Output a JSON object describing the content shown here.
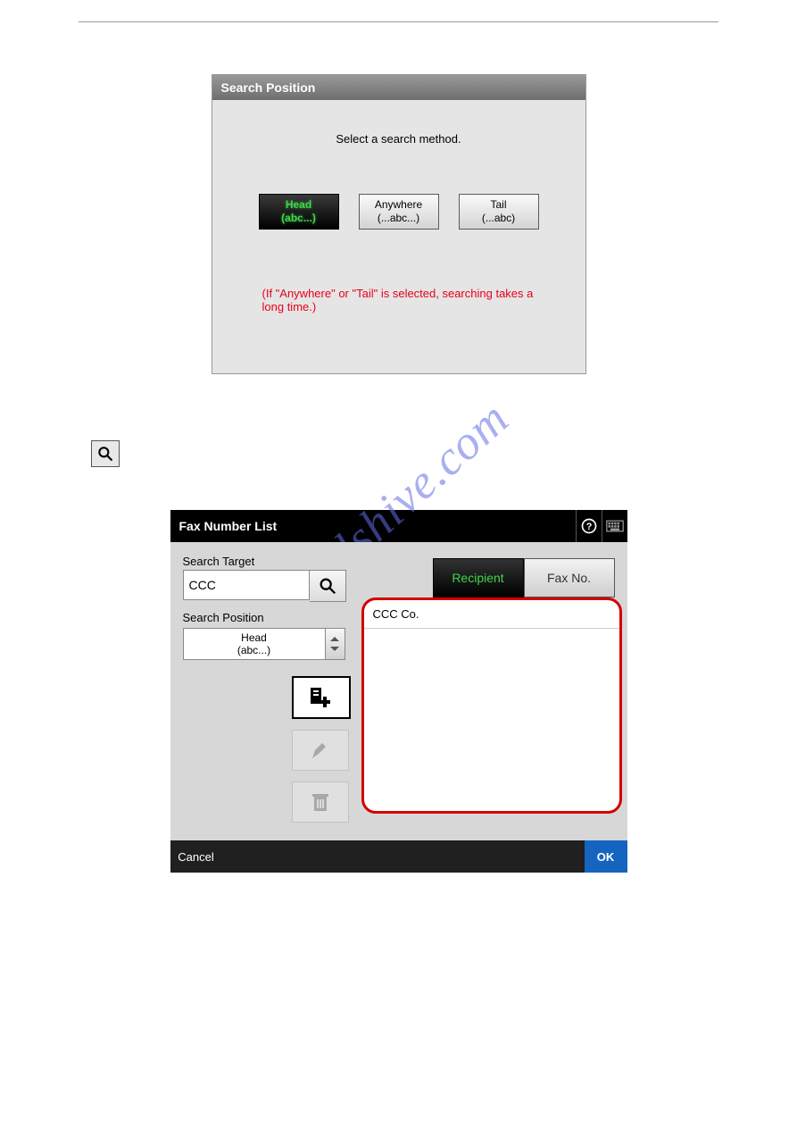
{
  "panel1": {
    "title": "Search Position",
    "prompt": "Select a search method.",
    "options": [
      {
        "label1": "Head",
        "label2": "(abc...)",
        "selected": true
      },
      {
        "label1": "Anywhere",
        "label2": "(...abc...)",
        "selected": false
      },
      {
        "label1": "Tail",
        "label2": "(...abc)",
        "selected": false
      }
    ],
    "warning": "(If \"Anywhere\" or \"Tail\" is selected, searching takes a long time.)"
  },
  "panel2": {
    "title": "Fax Number List",
    "search_target_label": "Search Target",
    "search_target_value": "CCC",
    "search_position_label": "Search Position",
    "search_position_value_line1": "Head",
    "search_position_value_line2": "(abc...)",
    "tabs": {
      "recipient": "Recipient",
      "faxno": "Fax No."
    },
    "results": [
      "CCC Co."
    ],
    "cancel": "Cancel",
    "ok": "OK"
  },
  "watermark": "manualshive.com"
}
